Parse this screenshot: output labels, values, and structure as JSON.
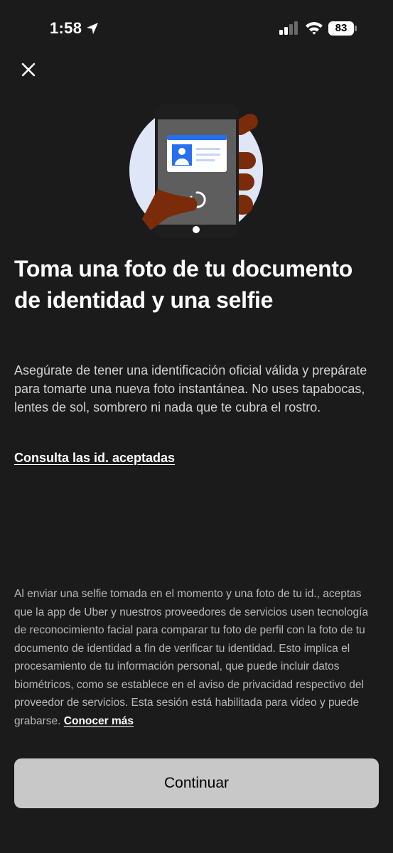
{
  "status_bar": {
    "time": "1:58",
    "battery": "83",
    "icons": [
      "location-arrow-icon",
      "cellular-signal-icon",
      "wifi-icon",
      "battery-icon"
    ]
  },
  "header": {
    "close_icon": "close-icon"
  },
  "hero": {
    "illustration": "phone-id-card-hand-illustration",
    "colors": {
      "circle": "#dfe6f7",
      "phone": "#5e5e5e",
      "hand": "#7a2c0a",
      "card_header": "#276ef1"
    }
  },
  "content": {
    "title": "Toma una foto de tu documento de identidad y una selfie",
    "description": "Asegúrate de tener una identificación oficial válida y prepárate para tomarte una nueva foto instantánea. No uses tapabocas, lentes de sol, sombrero ni nada que te cubra el rostro.",
    "accepted_ids_link": "Consulta las id. aceptadas"
  },
  "legal": {
    "text": "Al enviar una selfie tomada en el momento y una foto de tu id., aceptas que la app de Uber y nuestros proveedores de servicios usen tecnología de reconocimiento facial para comparar tu foto de perfil con la foto de tu documento de identidad a fin de verificar tu identidad. Esto implica el procesamiento de tu información personal, que puede incluir datos biométricos, como se establece en el aviso de privacidad respectivo del proveedor de servicios. Esta sesión está habilitada para video y puede grabarse.",
    "learn_more_link": "Conocer más"
  },
  "footer": {
    "continue_label": "Continuar"
  },
  "colors": {
    "background": "#1b1b1b",
    "button": "#c8c8c8",
    "text_primary": "#ffffff",
    "text_secondary": "#d2d2d2"
  }
}
